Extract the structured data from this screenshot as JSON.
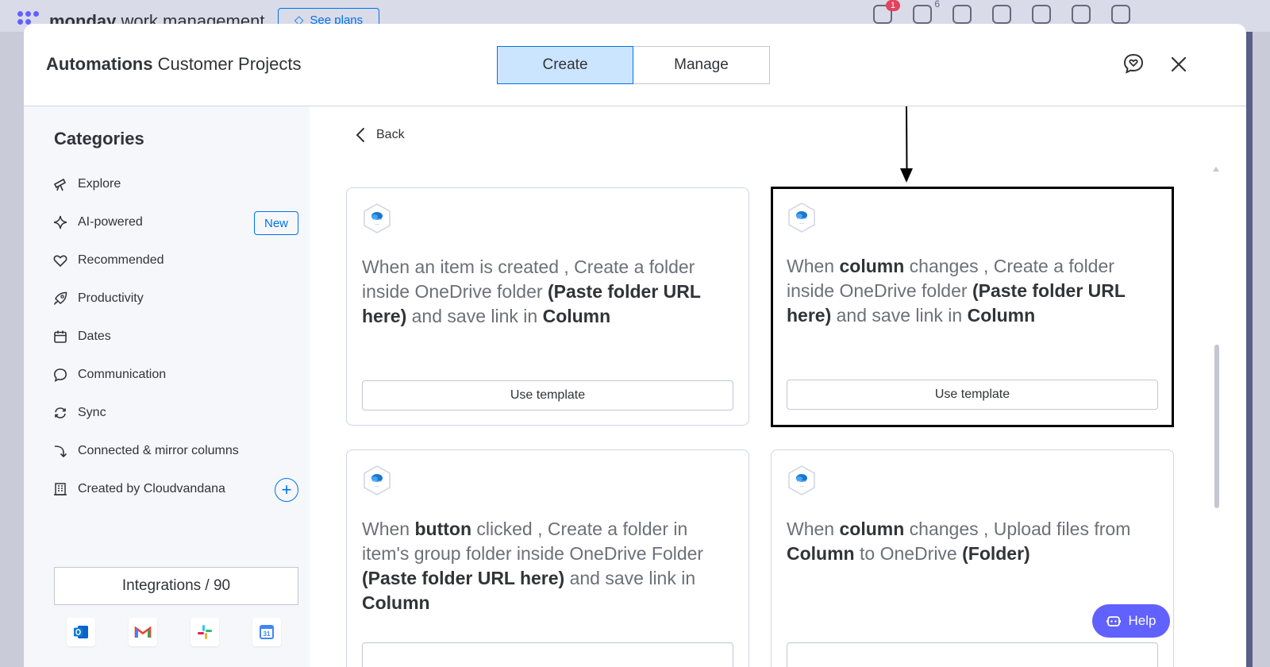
{
  "background": {
    "brand_bold": "monday",
    "brand_light": " work management",
    "see_plans": "See plans",
    "notif_badge": "1",
    "inbox_count": "6"
  },
  "header": {
    "title_bold": "Automations",
    "title_board": " Customer Projects",
    "tabs": [
      {
        "label": "Create",
        "active": true
      },
      {
        "label": "Manage",
        "active": false
      }
    ]
  },
  "sidebar": {
    "title": "Categories",
    "items": [
      {
        "label": "Explore",
        "icon": "telescope-icon"
      },
      {
        "label": "AI-powered",
        "icon": "sparkle-icon",
        "badge": "New"
      },
      {
        "label": "Recommended",
        "icon": "heart-icon"
      },
      {
        "label": "Productivity",
        "icon": "rocket-icon"
      },
      {
        "label": "Dates",
        "icon": "calendar-icon"
      },
      {
        "label": "Communication",
        "icon": "chat-bubble-icon"
      },
      {
        "label": "Sync",
        "icon": "sync-icon"
      },
      {
        "label": "Connected & mirror columns",
        "icon": "connect-arrow-icon"
      },
      {
        "label": "Created by Cloudvandana",
        "icon": "building-icon"
      }
    ],
    "integrations_label": "Integrations / 90",
    "integration_icons": [
      "outlook-icon",
      "gmail-icon",
      "slack-icon",
      "google-calendar-icon"
    ]
  },
  "main": {
    "back_label": "Back",
    "use_template_label": "Use template",
    "cards": [
      {
        "parts": [
          {
            "t": "When an item is created , Create a folder inside OneDrive folder ",
            "b": false
          },
          {
            "t": "(Paste folder URL here)",
            "b": true
          },
          {
            "t": " and save link in ",
            "b": false
          },
          {
            "t": "Column",
            "b": true
          }
        ]
      },
      {
        "parts": [
          {
            "t": "When ",
            "b": false
          },
          {
            "t": "column",
            "b": true
          },
          {
            "t": " changes , Create a folder inside OneDrive folder ",
            "b": false
          },
          {
            "t": "(Paste folder URL here)",
            "b": true
          },
          {
            "t": " and save link in ",
            "b": false
          },
          {
            "t": "Column",
            "b": true
          }
        ]
      },
      {
        "parts": [
          {
            "t": "When ",
            "b": false
          },
          {
            "t": "button",
            "b": true
          },
          {
            "t": " clicked , Create a folder in item's group folder inside OneDrive Folder ",
            "b": false
          },
          {
            "t": "(Paste folder URL here)",
            "b": true
          },
          {
            "t": " and save link in ",
            "b": false
          },
          {
            "t": "Column",
            "b": true
          }
        ]
      },
      {
        "parts": [
          {
            "t": "When ",
            "b": false
          },
          {
            "t": "column",
            "b": true
          },
          {
            "t": " changes , Upload files from ",
            "b": false
          },
          {
            "t": "Column",
            "b": true
          },
          {
            "t": " to OneDrive ",
            "b": false
          },
          {
            "t": "(Folder)",
            "b": true
          }
        ]
      }
    ]
  },
  "help_label": "Help",
  "colors": {
    "primary": "#0073ea",
    "tab_active_bg": "#cce5ff",
    "help_bg": "#6161ff",
    "highlight_border": "#000000"
  }
}
